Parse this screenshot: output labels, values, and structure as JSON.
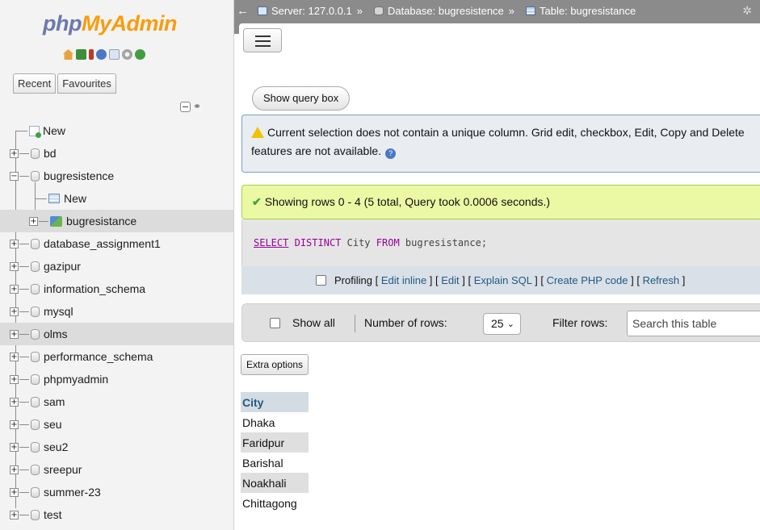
{
  "sidebar": {
    "logo_part1": "php",
    "logo_part2": "MyAdmin",
    "tabs": [
      "Recent",
      "Favourites"
    ],
    "link_icon": "⚭",
    "tree": [
      {
        "label": "New",
        "type": "new"
      },
      {
        "label": "bd",
        "type": "db"
      },
      {
        "label": "bugresistence",
        "type": "db",
        "expanded": true
      },
      {
        "label": "New",
        "type": "new-table"
      },
      {
        "label": "bugresistance",
        "type": "view"
      },
      {
        "label": "database_assignment1",
        "type": "db"
      },
      {
        "label": "gazipur",
        "type": "db"
      },
      {
        "label": "information_schema",
        "type": "db"
      },
      {
        "label": "mysql",
        "type": "db"
      },
      {
        "label": "olms",
        "type": "db"
      },
      {
        "label": "performance_schema",
        "type": "db"
      },
      {
        "label": "phpmyadmin",
        "type": "db"
      },
      {
        "label": "sam",
        "type": "db"
      },
      {
        "label": "seu",
        "type": "db"
      },
      {
        "label": "seu2",
        "type": "db"
      },
      {
        "label": "sreepur",
        "type": "db"
      },
      {
        "label": "summer-23",
        "type": "db"
      },
      {
        "label": "test",
        "type": "db"
      }
    ]
  },
  "breadcrumb": {
    "back": "←",
    "server": "Server: 127.0.0.1",
    "separator": "»",
    "database": "Database: bugresistence",
    "table": "Table: bugresistance",
    "settings_icon": "gear-icon"
  },
  "main": {
    "show_query_box": "Show query box",
    "notice_text": "Current selection does not contain a unique column. Grid edit, checkbox, Edit, Copy and Delete features are not available.",
    "success_text": "Showing rows 0 - 4 (5 total, Query took 0.0006 seconds.)",
    "sql": {
      "kw1": "SELECT",
      "kw2": "DISTINCT",
      "ident": "City",
      "kw3": "FROM",
      "rest": "bugresistance;"
    },
    "profiling": {
      "label": "Profiling",
      "links": [
        "Edit inline",
        "Edit",
        "Explain SQL",
        "Create PHP code",
        "Refresh"
      ]
    },
    "nav": {
      "show_all": "Show all",
      "number_of_rows_label": "Number of rows:",
      "rows_value": "25",
      "filter_label": "Filter rows:",
      "search_placeholder": "Search this table"
    },
    "extra_options": "Extra options",
    "results": {
      "column": "City",
      "rows": [
        "Dhaka",
        "Faridpur",
        "Barishal",
        "Noakhali",
        "Chittagong"
      ]
    }
  }
}
